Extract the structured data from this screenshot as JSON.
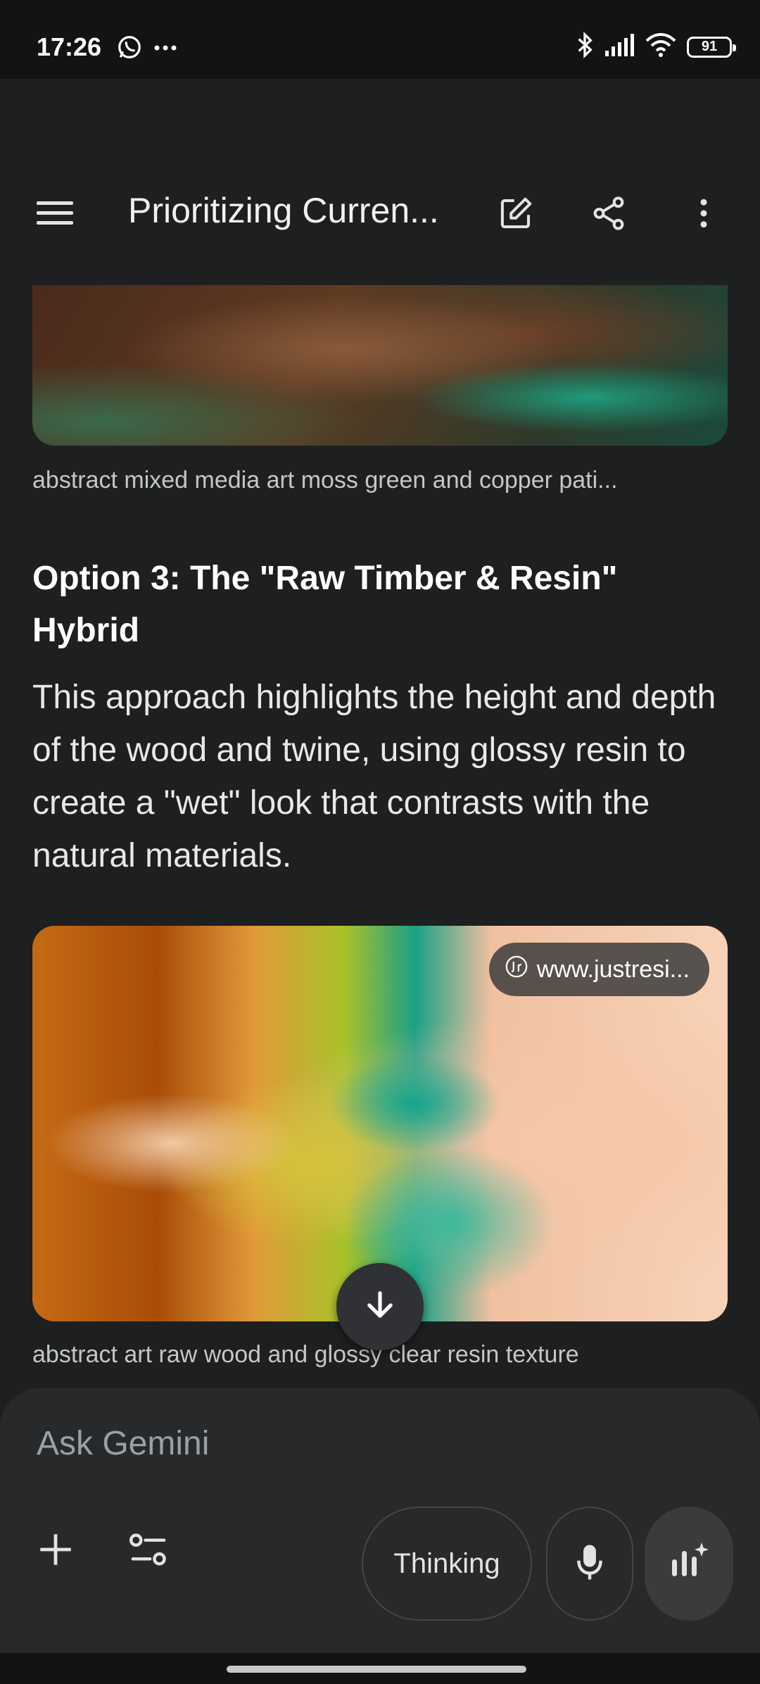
{
  "status_bar": {
    "time": "17:26",
    "left_icons": [
      "whatsapp-icon",
      "more-dots-icon"
    ],
    "right_icons": [
      "bluetooth-icon",
      "signal-icon",
      "wifi-icon"
    ],
    "battery": "91"
  },
  "app_bar": {
    "title": "Prioritizing Curren...",
    "icons": [
      "menu-icon",
      "edit-icon",
      "share-icon",
      "more-vert-icon"
    ]
  },
  "content": {
    "image_1_caption": "abstract mixed media art moss green and copper pati...",
    "option_heading": "Option 3: The \"Raw Timber & Resin\" Hybrid",
    "option_body": "This approach highlights the height and depth of the wood and twine, using glossy resin to create a \"wet\" look that contrasts with the natural materials.",
    "image_2_source": "www.justresi...",
    "image_2_caption": "abstract art raw wood and glossy clear resin texture"
  },
  "input": {
    "placeholder": "Ask Gemini",
    "thinking_label": "Thinking",
    "icons": [
      "plus-icon",
      "tools-icon",
      "microphone-icon",
      "live-icon"
    ]
  }
}
